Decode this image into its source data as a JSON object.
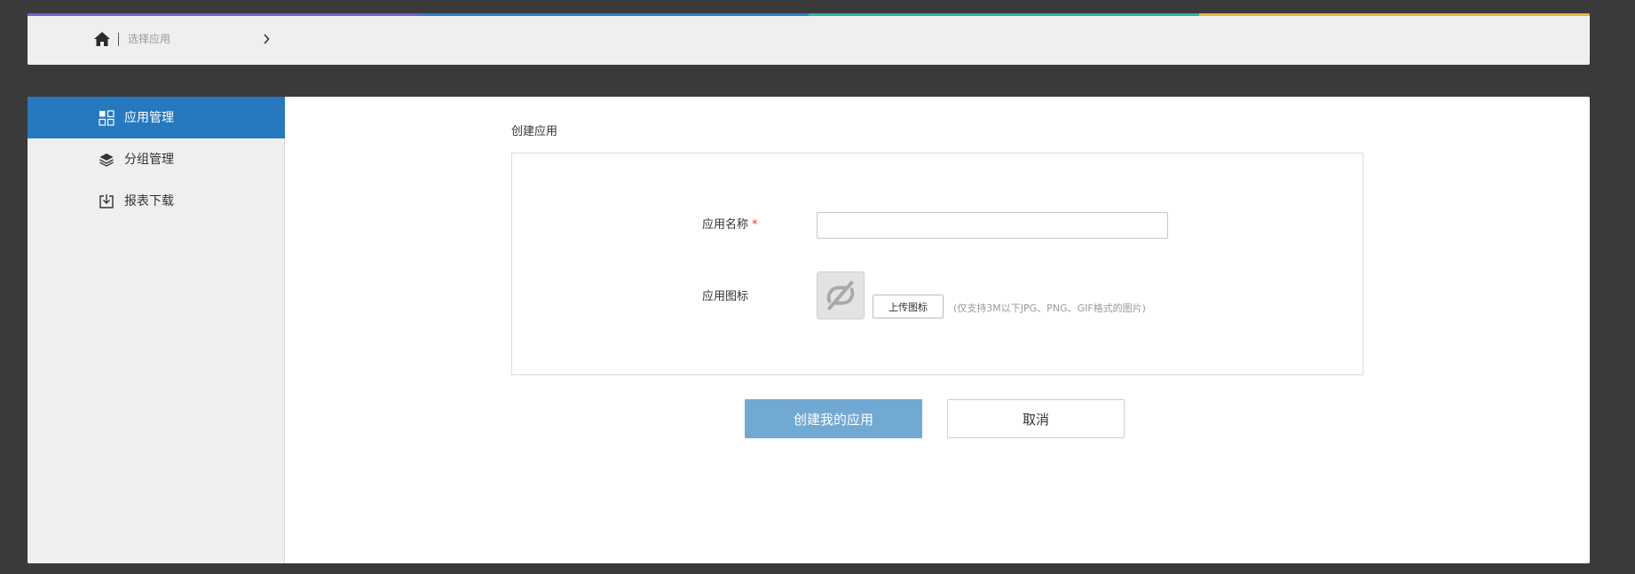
{
  "colors": {
    "strip": [
      "#7b5fc6",
      "#2d7fc8",
      "#2bb59c",
      "#f2ae3c"
    ],
    "accent": "#2679bf",
    "primary_button": "#72a9d3",
    "required": "#e33333"
  },
  "breadcrumb": {
    "home_icon": "home-icon",
    "current": "选择应用",
    "chevron_icon": "chevron-right-icon"
  },
  "sidebar": {
    "items": [
      {
        "label": "应用管理",
        "icon": "grid-icon",
        "active": true
      },
      {
        "label": "分组管理",
        "icon": "layers-icon",
        "active": false
      },
      {
        "label": "报表下载",
        "icon": "download-icon",
        "active": false
      }
    ]
  },
  "main": {
    "title": "创建应用",
    "form": {
      "name_label": "应用名称",
      "required_mark": "*",
      "name_value": "",
      "icon_label": "应用图标",
      "icon_placeholder": "app-icon-placeholder",
      "upload_button": "上传图标",
      "upload_hint": "(仅支持3M以下JPG、PNG、GIF格式的图片)"
    },
    "actions": {
      "submit": "创建我的应用",
      "cancel": "取消"
    }
  }
}
